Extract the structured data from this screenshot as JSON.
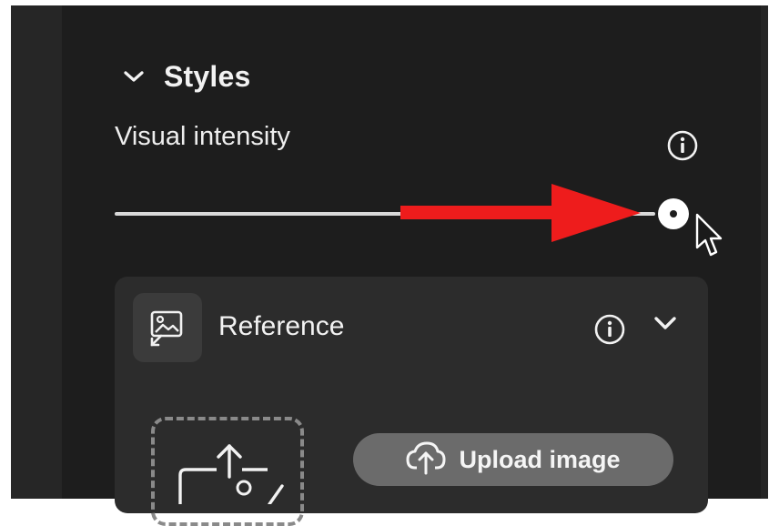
{
  "styles_section": {
    "title": "Styles",
    "chevron_icon": "chevron-down-icon"
  },
  "visual_intensity": {
    "label": "Visual intensity",
    "info_icon": "info-icon",
    "slider_value_fraction": 0.96
  },
  "annotation": {
    "arrow_color": "#ee1c1c",
    "arrow_direction": "right"
  },
  "reference": {
    "label": "Reference",
    "icon": "image-reference-icon",
    "info_icon": "info-icon",
    "chevron_icon": "chevron-down-icon",
    "drop_zone_icon": "image-upload-icon",
    "upload_button_label": "Upload image",
    "upload_button_icon": "cloud-upload-icon"
  },
  "colors": {
    "panel_bg": "#1d1d1d",
    "card_bg": "#2c2c2c",
    "button_bg": "#6b6b6b"
  }
}
